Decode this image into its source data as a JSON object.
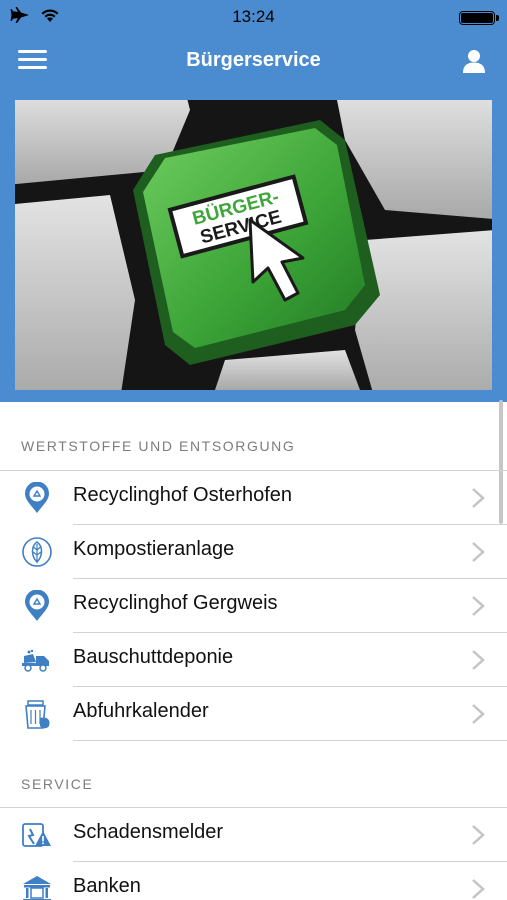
{
  "status": {
    "time": "13:24"
  },
  "navbar": {
    "title": "Bürgerservice"
  },
  "hero": {
    "key_text_line1": "BÜRGER-",
    "key_text_line2": "SERVICE"
  },
  "sections": [
    {
      "header": "WERTSTOFFE UND ENTSORGUNG",
      "items": [
        {
          "label": "Recyclinghof Osterhofen",
          "icon": "recycling-pin-icon"
        },
        {
          "label": "Kompostieranlage",
          "icon": "leaf-icon"
        },
        {
          "label": "Recyclinghof Gergweis",
          "icon": "recycling-pin-icon"
        },
        {
          "label": "Bauschuttdeponie",
          "icon": "dump-truck-icon"
        },
        {
          "label": "Abfuhrkalender",
          "icon": "trash-bin-icon"
        }
      ]
    },
    {
      "header": "SERVICE",
      "items": [
        {
          "label": "Schadensmelder",
          "icon": "report-damage-icon"
        },
        {
          "label": "Banken",
          "icon": "bank-icon"
        }
      ]
    }
  ],
  "colors": {
    "navbar": "#4a8ccf",
    "icon": "#3f7fc4",
    "key_green": "#3fa63a"
  }
}
